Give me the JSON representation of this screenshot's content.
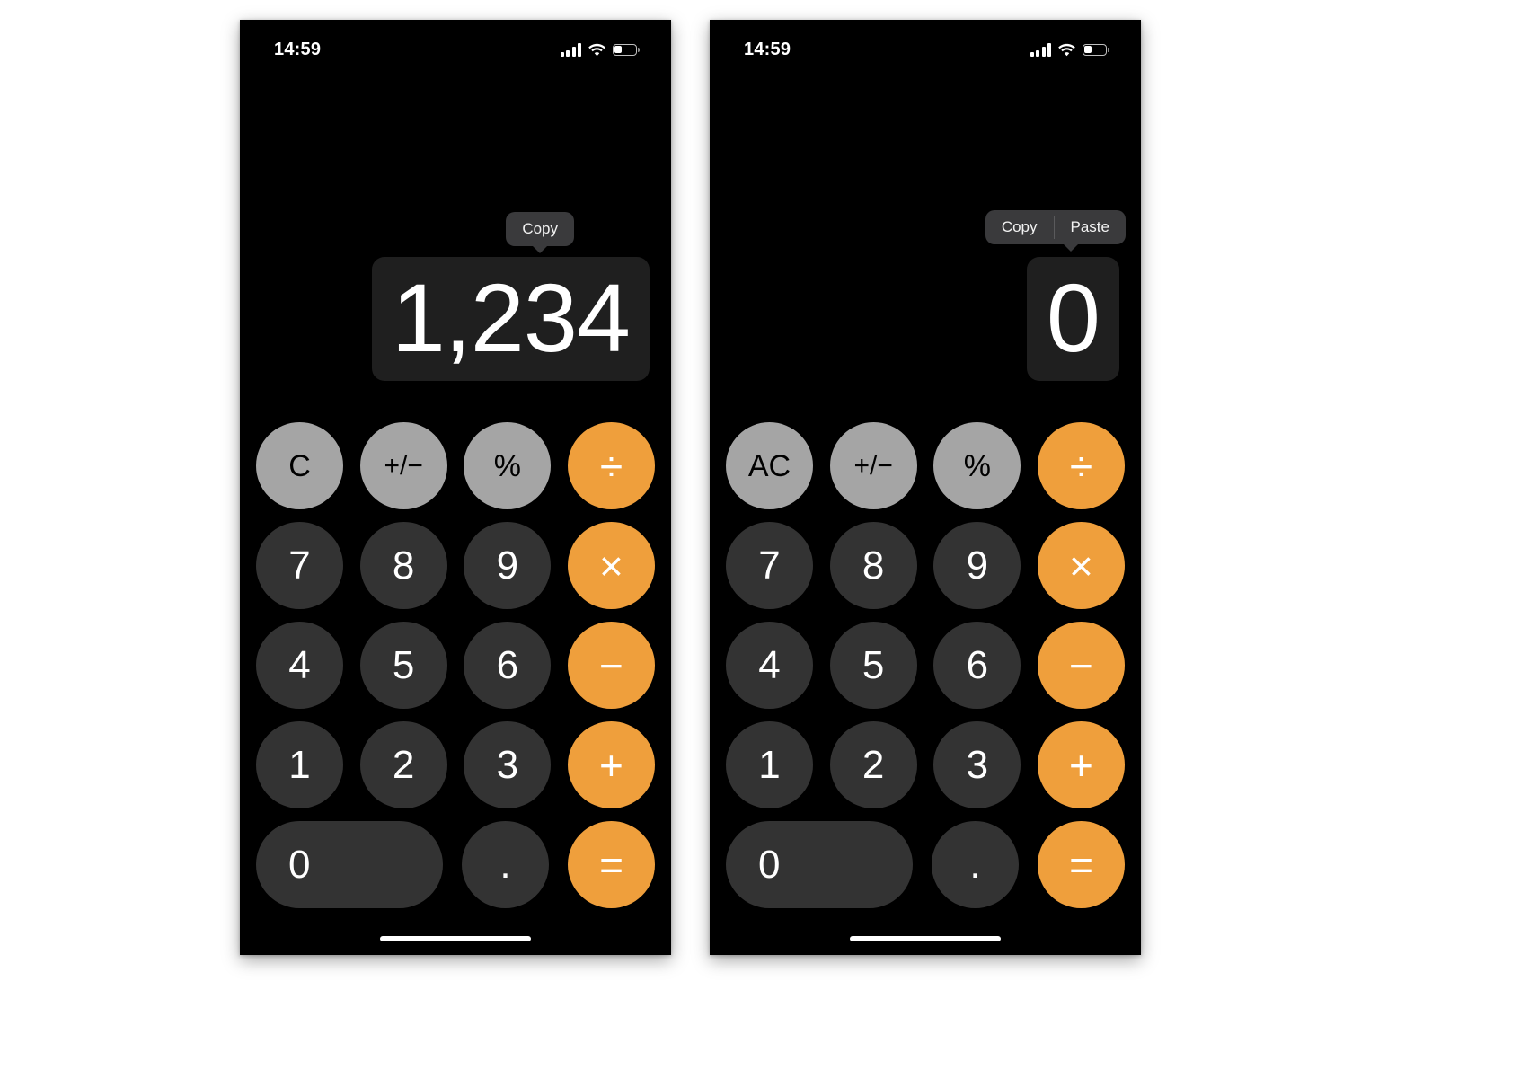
{
  "meta": {
    "background": "#ffffff",
    "screen_background": "#000000",
    "accent_orange": "#ef9f3c",
    "light_gray": "#a5a5a5",
    "dark_gray": "#333333",
    "menu_gray": "#3a3a3c",
    "selection_gray": "#1f1f1f"
  },
  "phones": [
    {
      "id": "left",
      "status": {
        "time": "14:59",
        "cellular_icon": "cellular-signal-icon",
        "wifi_icon": "wifi-icon",
        "battery_icon": "battery-icon",
        "battery_level_pct": 35
      },
      "display": {
        "value": "1,234",
        "selected": true
      },
      "edit_menu": {
        "items": [
          "Copy"
        ]
      },
      "keypad": {
        "rows": [
          [
            {
              "label": "C",
              "style": "light",
              "kind": "func",
              "name": "key-clear"
            },
            {
              "label": "+/−",
              "style": "light",
              "kind": "func-small",
              "name": "key-plus-minus"
            },
            {
              "label": "%",
              "style": "light",
              "kind": "func",
              "name": "key-percent"
            },
            {
              "label": "÷",
              "style": "orange",
              "kind": "op",
              "name": "key-divide"
            }
          ],
          [
            {
              "label": "7",
              "style": "dark",
              "kind": "digit",
              "name": "key-7"
            },
            {
              "label": "8",
              "style": "dark",
              "kind": "digit",
              "name": "key-8"
            },
            {
              "label": "9",
              "style": "dark",
              "kind": "digit",
              "name": "key-9"
            },
            {
              "label": "×",
              "style": "orange",
              "kind": "op",
              "name": "key-multiply"
            }
          ],
          [
            {
              "label": "4",
              "style": "dark",
              "kind": "digit",
              "name": "key-4"
            },
            {
              "label": "5",
              "style": "dark",
              "kind": "digit",
              "name": "key-5"
            },
            {
              "label": "6",
              "style": "dark",
              "kind": "digit",
              "name": "key-6"
            },
            {
              "label": "−",
              "style": "orange",
              "kind": "op",
              "name": "key-minus"
            }
          ],
          [
            {
              "label": "1",
              "style": "dark",
              "kind": "digit",
              "name": "key-1"
            },
            {
              "label": "2",
              "style": "dark",
              "kind": "digit",
              "name": "key-2"
            },
            {
              "label": "3",
              "style": "dark",
              "kind": "digit",
              "name": "key-3"
            },
            {
              "label": "+",
              "style": "orange",
              "kind": "op",
              "name": "key-plus"
            }
          ],
          [
            {
              "label": "0",
              "style": "dark",
              "kind": "digit",
              "wide": true,
              "name": "key-0"
            },
            {
              "label": ".",
              "style": "dark",
              "kind": "digit",
              "name": "key-decimal"
            },
            {
              "label": "=",
              "style": "orange",
              "kind": "op",
              "name": "key-equals"
            }
          ]
        ]
      }
    },
    {
      "id": "right",
      "status": {
        "time": "14:59",
        "cellular_icon": "cellular-signal-icon",
        "wifi_icon": "wifi-icon",
        "battery_icon": "battery-icon",
        "battery_level_pct": 35
      },
      "display": {
        "value": "0",
        "selected": true
      },
      "edit_menu": {
        "items": [
          "Copy",
          "Paste"
        ]
      },
      "keypad": {
        "rows": [
          [
            {
              "label": "AC",
              "style": "light",
              "kind": "func",
              "name": "key-all-clear"
            },
            {
              "label": "+/−",
              "style": "light",
              "kind": "func-small",
              "name": "key-plus-minus"
            },
            {
              "label": "%",
              "style": "light",
              "kind": "func",
              "name": "key-percent"
            },
            {
              "label": "÷",
              "style": "orange",
              "kind": "op",
              "name": "key-divide"
            }
          ],
          [
            {
              "label": "7",
              "style": "dark",
              "kind": "digit",
              "name": "key-7"
            },
            {
              "label": "8",
              "style": "dark",
              "kind": "digit",
              "name": "key-8"
            },
            {
              "label": "9",
              "style": "dark",
              "kind": "digit",
              "name": "key-9"
            },
            {
              "label": "×",
              "style": "orange",
              "kind": "op",
              "name": "key-multiply"
            }
          ],
          [
            {
              "label": "4",
              "style": "dark",
              "kind": "digit",
              "name": "key-4"
            },
            {
              "label": "5",
              "style": "dark",
              "kind": "digit",
              "name": "key-5"
            },
            {
              "label": "6",
              "style": "dark",
              "kind": "digit",
              "name": "key-6"
            },
            {
              "label": "−",
              "style": "orange",
              "kind": "op",
              "name": "key-minus"
            }
          ],
          [
            {
              "label": "1",
              "style": "dark",
              "kind": "digit",
              "name": "key-1"
            },
            {
              "label": "2",
              "style": "dark",
              "kind": "digit",
              "name": "key-2"
            },
            {
              "label": "3",
              "style": "dark",
              "kind": "digit",
              "name": "key-3"
            },
            {
              "label": "+",
              "style": "orange",
              "kind": "op",
              "name": "key-plus"
            }
          ],
          [
            {
              "label": "0",
              "style": "dark",
              "kind": "digit",
              "wide": true,
              "name": "key-0"
            },
            {
              "label": ".",
              "style": "dark",
              "kind": "digit",
              "name": "key-decimal"
            },
            {
              "label": "=",
              "style": "orange",
              "kind": "op",
              "name": "key-equals"
            }
          ]
        ]
      }
    }
  ]
}
